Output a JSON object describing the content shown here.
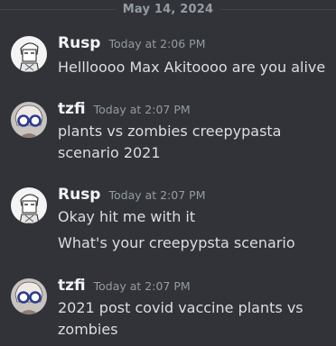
{
  "date_divider": "May 14, 2024",
  "messages": [
    {
      "username": "Rusp",
      "timestamp": "Today at 2:06 PM",
      "lines": [
        "Hellloooo Max Akitoooo are you alive"
      ]
    },
    {
      "username": "tzfi",
      "timestamp": "Today at 2:07 PM",
      "lines": [
        "plants vs zombies creepypasta",
        "scenario 2021"
      ]
    },
    {
      "username": "Rusp",
      "timestamp": "Today at 2:07 PM",
      "lines": [
        "Okay hit me with it",
        "What's your creepypsta scenario"
      ]
    },
    {
      "username": "tzfi",
      "timestamp": "Today at 2:07 PM",
      "lines": [
        "2021 post covid vaccine plants vs",
        "zombies"
      ]
    }
  ],
  "avatars": {
    "rusp": "cartoon-character-avatar",
    "tzfi": "glasses-character-avatar"
  }
}
